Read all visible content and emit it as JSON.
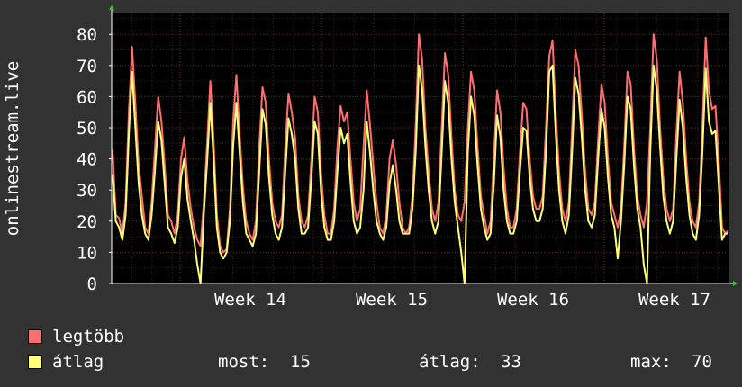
{
  "chart_data": {
    "type": "line",
    "ylabel": "onlinestream.live",
    "ylim": [
      0,
      87
    ],
    "yticks": [
      0,
      10,
      20,
      30,
      40,
      50,
      60,
      70,
      80
    ],
    "xlabels": [
      "Week 14",
      "Week 15",
      "Week 16",
      "Week 17"
    ],
    "grid": true,
    "colors": {
      "background": "#323232",
      "plot": "#000000",
      "grid": "#5a2a2a",
      "axis": "#ffffff"
    },
    "series": [
      {
        "name": "legtöbb",
        "color": "#ff6f6f",
        "values": [
          43,
          22,
          21,
          16,
          26,
          55,
          76,
          58,
          38,
          28,
          18,
          16,
          26,
          43,
          60,
          52,
          38,
          22,
          20,
          16,
          22,
          40,
          47,
          33,
          24,
          18,
          14,
          12,
          26,
          45,
          65,
          46,
          22,
          12,
          10,
          11,
          24,
          52,
          67,
          48,
          31,
          20,
          16,
          14,
          20,
          44,
          63,
          58,
          40,
          26,
          20,
          18,
          22,
          44,
          61,
          55,
          47,
          28,
          20,
          18,
          22,
          40,
          60,
          55,
          35,
          22,
          16,
          16,
          24,
          44,
          57,
          52,
          55,
          40,
          26,
          20,
          24,
          44,
          62,
          51,
          38,
          26,
          18,
          16,
          22,
          40,
          46,
          38,
          26,
          18,
          16,
          18,
          28,
          50,
          80,
          72,
          50,
          36,
          24,
          20,
          26,
          50,
          74,
          67,
          47,
          30,
          22,
          20,
          26,
          50,
          68,
          62,
          44,
          28,
          22,
          16,
          20,
          40,
          62,
          55,
          37,
          24,
          18,
          18,
          24,
          42,
          58,
          56,
          40,
          28,
          24,
          24,
          28,
          50,
          73,
          78,
          55,
          36,
          24,
          20,
          26,
          50,
          75,
          70,
          54,
          36,
          24,
          22,
          26,
          46,
          64,
          58,
          40,
          26,
          22,
          18,
          24,
          44,
          68,
          64,
          44,
          28,
          22,
          18,
          26,
          50,
          80,
          72,
          50,
          34,
          24,
          20,
          24,
          48,
          68,
          58,
          40,
          26,
          20,
          18,
          26,
          50,
          79,
          62,
          56,
          57,
          40,
          18,
          16,
          17
        ]
      },
      {
        "name": "átlag",
        "color": "#ffff7a",
        "values": [
          35,
          20,
          18,
          14,
          22,
          48,
          68,
          50,
          32,
          22,
          16,
          14,
          22,
          36,
          52,
          46,
          32,
          18,
          16,
          13,
          18,
          34,
          40,
          27,
          20,
          14,
          6,
          0,
          22,
          39,
          58,
          40,
          18,
          10,
          8,
          10,
          20,
          44,
          58,
          42,
          26,
          16,
          14,
          12,
          16,
          36,
          56,
          51,
          34,
          22,
          16,
          14,
          18,
          36,
          53,
          48,
          40,
          24,
          16,
          16,
          18,
          34,
          52,
          48,
          29,
          18,
          14,
          14,
          20,
          36,
          50,
          45,
          48,
          33,
          20,
          16,
          18,
          30,
          52,
          42,
          30,
          20,
          16,
          14,
          18,
          32,
          38,
          30,
          20,
          16,
          16,
          16,
          24,
          42,
          70,
          62,
          44,
          30,
          20,
          16,
          20,
          42,
          65,
          58,
          40,
          26,
          18,
          10,
          0,
          42,
          60,
          54,
          38,
          24,
          18,
          14,
          16,
          32,
          54,
          47,
          30,
          20,
          16,
          16,
          20,
          36,
          50,
          49,
          34,
          24,
          20,
          20,
          24,
          42,
          68,
          70,
          48,
          30,
          20,
          16,
          22,
          42,
          66,
          61,
          47,
          30,
          20,
          18,
          22,
          40,
          56,
          50,
          34,
          22,
          18,
          8,
          20,
          38,
          60,
          56,
          38,
          24,
          18,
          6,
          0,
          42,
          70,
          62,
          44,
          28,
          20,
          16,
          20,
          40,
          59,
          50,
          34,
          22,
          16,
          14,
          22,
          42,
          69,
          52,
          48,
          49,
          32,
          14,
          16,
          16
        ]
      }
    ],
    "stats": {
      "most_label": "most:",
      "most": "15",
      "atlag_label": "átlag:",
      "atlag": "33",
      "max_label": "max:",
      "max": "70"
    }
  }
}
